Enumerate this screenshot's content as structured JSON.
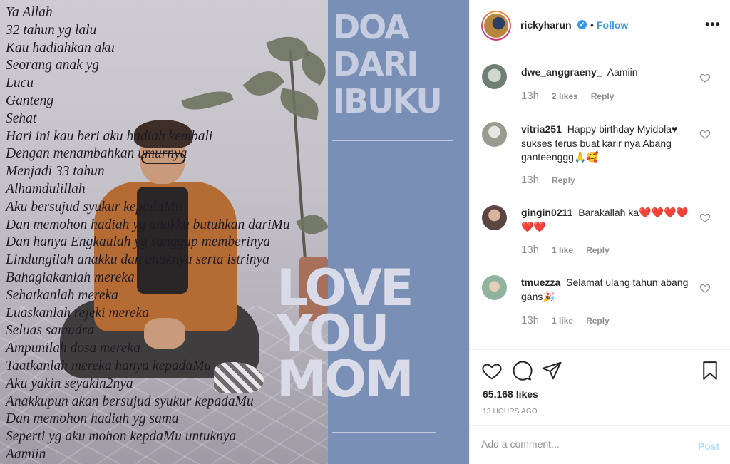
{
  "post_image": {
    "poem_lines": [
      "Ya Allah",
      "32 tahun yg lalu",
      "Kau hadiahkan aku",
      "Seorang anak yg",
      "Lucu",
      "Ganteng",
      "Sehat",
      "Hari ini kau beri aku hadiah kembali",
      "Dengan menambahkan umurnya",
      "Menjadi 33 tahun",
      "Alhamdulillah",
      "Aku bersujud syukur kepadaMu",
      "Dan memohon hadiah yg anakku butuhkan dariMu",
      "Dan hanya Engkaulah yg sanggup memberinya",
      "Lindungilah anakku dan anaknya serta istrinya",
      "Bahagiakanlah mereka",
      "Sehatkanlah mereka",
      "Luaskanlah rejeki mereka",
      "Seluas samudra",
      "Ampunilah dosa mereka",
      "Taatkanlah mereka hanya kepadaMu",
      "Aku yakin seyakin2nya",
      "Anakkupun akan bersujud syukur kepadaMu",
      "Dan memohon hadiah yg sama",
      "Seperti yg aku mohon kepdaMu untuknya",
      "Aamiin"
    ],
    "title_lines": [
      "DOA",
      "DARI",
      "IBUKU"
    ],
    "headline_lines": [
      "LOVE",
      "YOU",
      "MOM"
    ]
  },
  "header": {
    "username": "rickyharun",
    "verified_mark": "✓",
    "separator": "•",
    "follow_label": "Follow",
    "more_label": "•••"
  },
  "comments": [
    {
      "user": "dwe_anggraeny_",
      "text": "Aamiin",
      "time": "13h",
      "likes": "2 likes",
      "reply": "Reply"
    },
    {
      "user": "vitria251",
      "text": "Happy birthday Myidola♥ sukses terus buat karir nya Abang ganteenggg🙏🥰",
      "time": "13h",
      "likes": "",
      "reply": "Reply"
    },
    {
      "user": "gingin0211",
      "text": "Barakallah ka❤️❤️❤️❤️❤️❤️",
      "time": "13h",
      "likes": "1 like",
      "reply": "Reply"
    },
    {
      "user": "tmuezza",
      "text": "Selamat ulang tahun abang gans🎉",
      "time": "13h",
      "likes": "1 like",
      "reply": "Reply"
    }
  ],
  "actions": {
    "likes": "65,168 likes",
    "timestamp": "13 HOURS AGO"
  },
  "add_comment": {
    "placeholder": "Add a comment...",
    "post_label": "Post"
  },
  "icons": {
    "like": "heart-icon",
    "comment": "comment-icon",
    "share": "paper-plane-icon",
    "save": "bookmark-icon",
    "comment_like": "heart-icon"
  },
  "colors": {
    "link_blue": "#3897f0",
    "post_disabled": "#b2dffc",
    "muted": "#8e8e8e",
    "text": "#262626",
    "image_blue_panel": "#7a8fb6"
  }
}
